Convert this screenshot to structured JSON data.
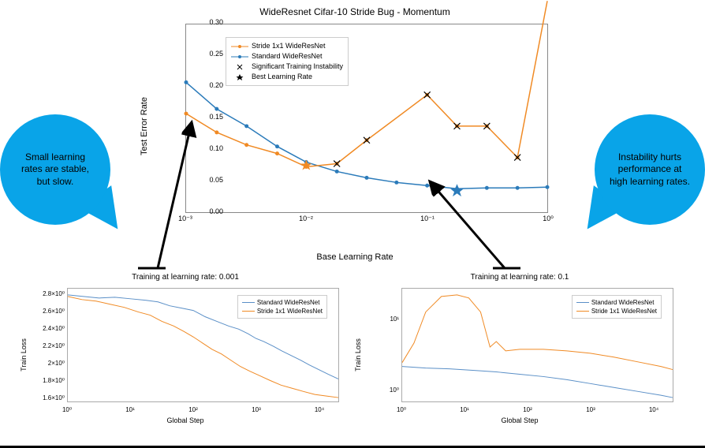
{
  "main": {
    "title": "WideResnet Cifar-10 Stride Bug - Momentum",
    "xlabel": "Base Learning Rate",
    "ylabel": "Test Error Rate",
    "legend": {
      "s1": "Stride 1x1 WideResNet",
      "s2": "Standard WideResNet",
      "instab": "Significant Training Instability",
      "best": "Best Learning Rate"
    },
    "xticks": [
      "10⁻³",
      "10⁻²",
      "10⁻¹",
      "10⁰"
    ],
    "yticks": [
      "0.00",
      "0.05",
      "0.10",
      "0.15",
      "0.20",
      "0.25",
      "0.30"
    ]
  },
  "speech": {
    "left": "Small learning rates are stable, but slow.",
    "right": "Instability hurts performance at high learning rates."
  },
  "subleft": {
    "title": "Training at learning rate: 0.001",
    "ylabel": "Train Loss",
    "xlabel": "Global Step",
    "xticks": [
      "10⁰",
      "10¹",
      "10²",
      "10³",
      "10⁴"
    ],
    "yticks": [
      "1.6×10⁰",
      "1.8×10⁰",
      "2×10⁰",
      "2.2×10⁰",
      "2.4×10⁰",
      "2.6×10⁰",
      "2.8×10⁰"
    ],
    "legend": {
      "a": "Standard WideResNet",
      "b": "Stride 1x1 WideResNet"
    }
  },
  "subright": {
    "title": "Training at learning rate: 0.1",
    "ylabel": "Train Loss",
    "xlabel": "Global Step",
    "xticks": [
      "10⁰",
      "10¹",
      "10²",
      "10³",
      "10⁴"
    ],
    "yticks": [
      "10⁰",
      "10¹"
    ],
    "legend": {
      "a": "Standard WideResNet",
      "b": "Stride 1x1 WideResNet"
    }
  },
  "chart_data": [
    {
      "type": "line",
      "title": "WideResnet Cifar-10 Stride Bug - Momentum",
      "xlabel": "Base Learning Rate",
      "ylabel": "Test Error Rate",
      "xscale": "log",
      "xlim": [
        0.001,
        1.0
      ],
      "ylim": [
        0.0,
        0.3
      ],
      "series": [
        {
          "name": "Stride 1x1 WideResNet",
          "color": "#f08a24",
          "x": [
            0.001,
            0.0018,
            0.0032,
            0.0056,
            0.01,
            0.018,
            0.032,
            0.1,
            0.18,
            0.32,
            0.5,
            1.0
          ],
          "y": [
            0.158,
            0.128,
            0.108,
            0.094,
            0.073,
            0.078,
            0.115,
            0.188,
            0.138,
            0.137,
            0.087,
            0.33
          ],
          "instability_x": [
            0.018,
            0.032,
            0.1,
            0.18,
            0.32,
            0.5
          ],
          "best_x": 0.01,
          "best_y": 0.073
        },
        {
          "name": "Standard WideResNet",
          "color": "#2b7bba",
          "x": [
            0.001,
            0.0018,
            0.0032,
            0.0056,
            0.01,
            0.018,
            0.032,
            0.056,
            0.1,
            0.18,
            0.32,
            0.56,
            1.0
          ],
          "y": [
            0.207,
            0.165,
            0.137,
            0.105,
            0.08,
            0.065,
            0.055,
            0.047,
            0.043,
            0.038,
            0.039,
            0.039,
            0.04
          ],
          "best_x": 0.18,
          "best_y": 0.038
        }
      ]
    },
    {
      "type": "line",
      "title": "Training at learning rate: 0.001",
      "xlabel": "Global Step",
      "ylabel": "Train Loss",
      "xscale": "log",
      "yscale": "log-ish",
      "xlim": [
        1,
        20000
      ],
      "ylim": [
        1.6,
        2.8
      ],
      "series": [
        {
          "name": "Standard WideResNet",
          "color": "#5a8fc7",
          "trend": "from ~2.75 at step 1 decreasing noisily to ~1.75 at step 2e4"
        },
        {
          "name": "Stride 1x1 WideResNet",
          "color": "#f08a24",
          "trend": "from ~2.75 at step 1 decreasing noisily to ~1.55 at step 2e4"
        }
      ]
    },
    {
      "type": "line",
      "title": "Training at learning rate: 0.1",
      "xlabel": "Global Step",
      "ylabel": "Train Loss",
      "xscale": "log",
      "yscale": "log",
      "xlim": [
        1,
        20000
      ],
      "ylim": [
        0.8,
        30
      ],
      "series": [
        {
          "name": "Standard WideResNet",
          "color": "#5a8fc7",
          "trend": "from ~2.5 decreasing smoothly to ~0.8 at step 2e4"
        },
        {
          "name": "Stride 1x1 WideResNet",
          "color": "#f08a24",
          "trend": "spikes from ~3 up to ~25 around step 10, drops to ~5, plateaus ~5, slowly declines to ~2"
        }
      ]
    }
  ]
}
